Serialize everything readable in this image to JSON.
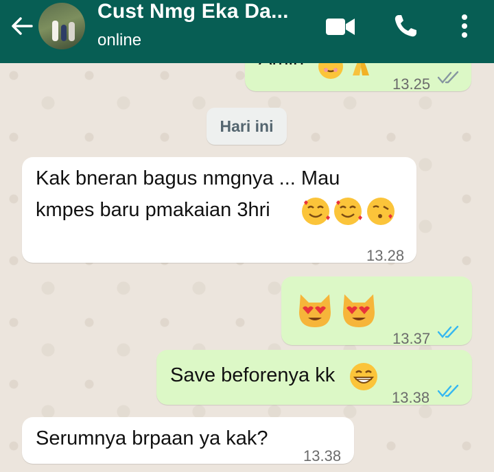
{
  "header": {
    "title": "Cust Nmg Eka Da...",
    "status": "online",
    "bg_color": "#075e54"
  },
  "messages": {
    "m1": {
      "text": "Amin",
      "time": "13.25",
      "direction": "outgoing",
      "read": true
    },
    "date_divider": "Hari ini",
    "m2": {
      "line1": "Kak bneran bagus nmgnya ... Mau",
      "line2": "kmpes baru pmakaian 3hri",
      "time": "13.28",
      "direction": "incoming"
    },
    "m3": {
      "time": "13.37",
      "direction": "outgoing",
      "read": true
    },
    "m4": {
      "text": "Save beforenya kk",
      "time": "13.38",
      "direction": "outgoing",
      "read": true
    },
    "m5": {
      "text": "Serumnya brpaan ya kak?",
      "time": "13.38",
      "direction": "incoming"
    }
  },
  "colors": {
    "outgoing_bubble": "#dcf8c6",
    "incoming_bubble": "#ffffff",
    "read_tick": "#34b7f1"
  },
  "icons": [
    "back-arrow-icon",
    "video-call-icon",
    "phone-icon",
    "more-options-icon",
    "smiling-face-with-hearts-emoji",
    "folded-hands-emoji",
    "face-blowing-kiss-emoji",
    "heart-eyes-cat-emoji",
    "grinning-face-emoji",
    "double-check-icon"
  ]
}
